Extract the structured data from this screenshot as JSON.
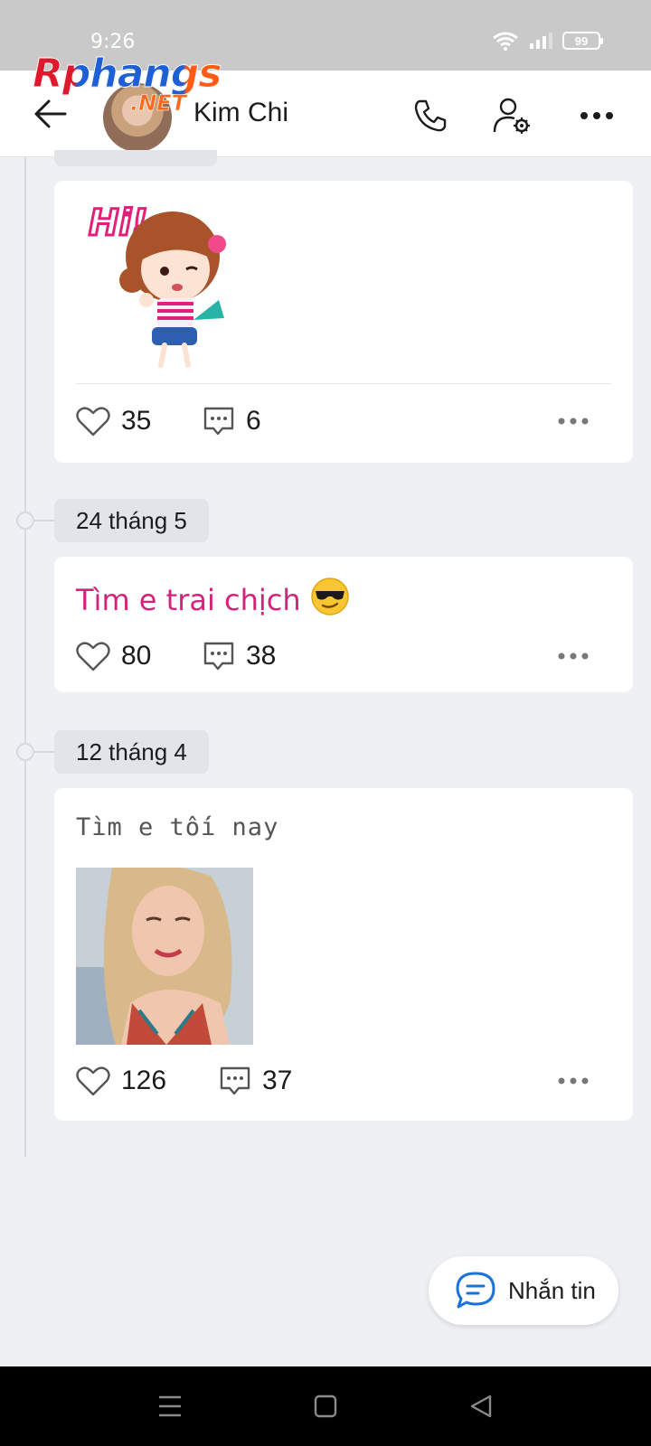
{
  "status_bar": {
    "time": "9:26",
    "battery": "99",
    "icons": [
      "wifi-icon",
      "signal-icon",
      "battery-icon"
    ]
  },
  "header": {
    "contact_name": "Kim Chi",
    "actions": [
      "back-arrow-icon",
      "phone-icon",
      "user-settings-icon",
      "more-icon"
    ]
  },
  "watermark": {
    "main": "Rphangs",
    "sub": ".NET"
  },
  "feed": [
    {
      "kind": "sticker",
      "sticker_text": "Hi!",
      "likes": "35",
      "comments": "6"
    },
    {
      "date": "24 tháng 5",
      "kind": "text",
      "text": "Tìm e trai chịch",
      "emoji": "😎",
      "likes": "80",
      "comments": "38"
    },
    {
      "date": "12 tháng 4",
      "kind": "photo",
      "text": "Tìm e tối nay",
      "likes": "126",
      "comments": "37"
    }
  ],
  "message_button": {
    "label": "Nhắn tin",
    "icon": "chat-bubble-icon"
  },
  "nav_bar": [
    "menu-icon",
    "home-icon",
    "back-icon"
  ],
  "colors": {
    "accent_pink": "#d4237a",
    "background": "#eff0f4",
    "message_icon": "#1a73d9"
  }
}
